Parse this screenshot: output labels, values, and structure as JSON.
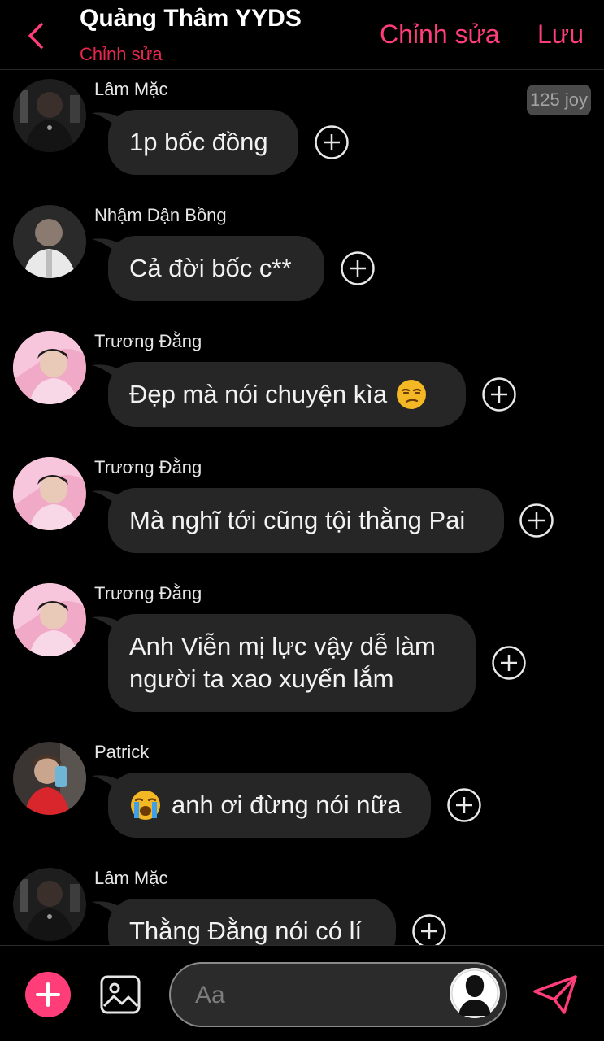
{
  "header": {
    "title": "Quảng Thâm YYDS",
    "subtitle": "Chỉnh sửa",
    "edit_label": "Chỉnh sửa",
    "save_label": "Lưu"
  },
  "messages": [
    {
      "sender": "Lâm Mặc",
      "text": "1p bốc đồng",
      "badge": "125 joy"
    },
    {
      "sender": "Nhậm Dận Bồng",
      "text": "Cả đời bốc c**"
    },
    {
      "sender": "Trương Đằng",
      "text": "Đẹp mà nói chuyện kìa",
      "emoji": "unamused-face"
    },
    {
      "sender": "Trương Đằng",
      "text": "Mà nghĩ tới cũng tội thằng Pai"
    },
    {
      "sender": "Trương Đằng",
      "line1": "Anh Viễn mị lực vậy dễ làm",
      "line2": "người ta xao xuyến lắm"
    },
    {
      "sender": "Patrick",
      "text": "anh ơi đừng nói nữa",
      "emoji": "loudly-crying-face"
    },
    {
      "sender": "Lâm Mặc",
      "text": "Thằng Đằng nói có lí"
    }
  ],
  "composer": {
    "placeholder": "Aa"
  },
  "colors": {
    "accent": "#ff3d79",
    "subtitle": "#e8274e",
    "bubble": "#262626",
    "background": "#000000"
  }
}
